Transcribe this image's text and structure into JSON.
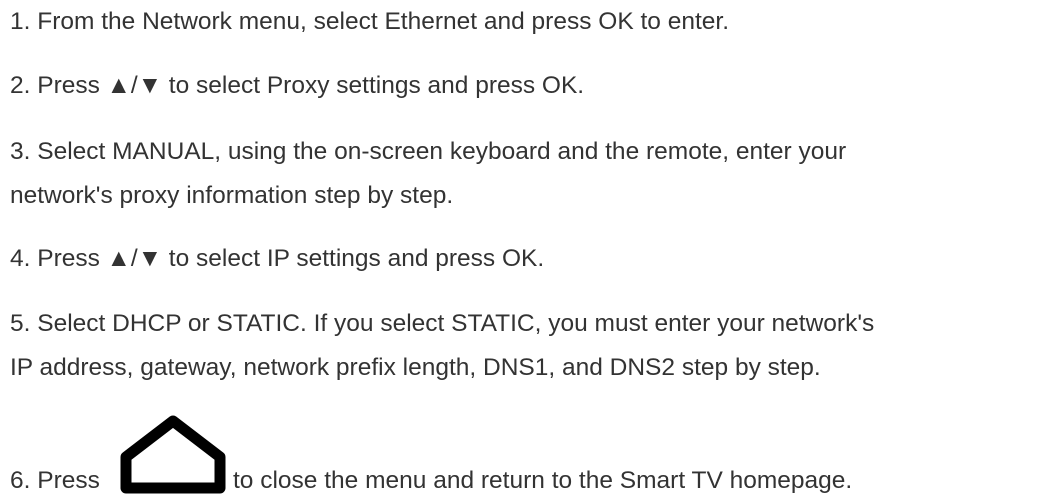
{
  "steps": [
    {
      "text": "1. From the Network menu, select Ethernet and press OK to enter."
    },
    {
      "text": "2. Press ▲/▼ to select Proxy settings and press OK."
    },
    {
      "text": "3. Select MANUAL, using the on-screen keyboard and the remote, enter your"
    },
    {
      "text": "network's proxy information step by step."
    },
    {
      "text": "4. Press ▲/▼ to select IP settings and press OK."
    },
    {
      "text": "5. Select DHCP or STATIC. If you select STATIC, you must enter your network's"
    },
    {
      "text": "IP address, gateway, network prefix length, DNS1, and DNS2 step by step."
    }
  ],
  "step6": {
    "before": "6. Press",
    "icon": "home-icon",
    "after": "to close the menu and return to the Smart TV homepage."
  }
}
